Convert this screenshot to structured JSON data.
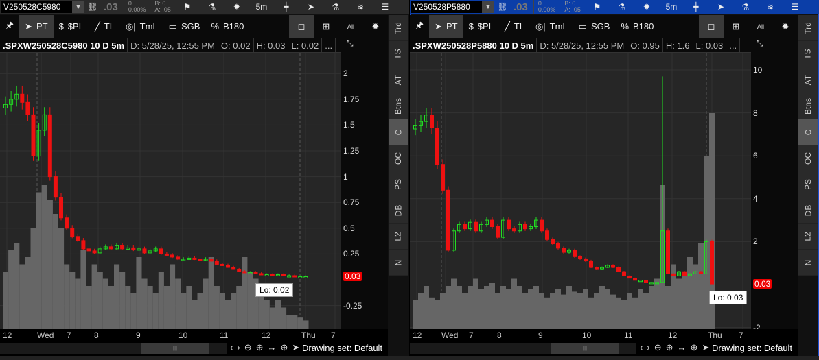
{
  "panels": [
    {
      "symbol": "V250528C5980",
      "last": ".03",
      "change": "0",
      "change_pct": "0.00%",
      "bid": "B: 0",
      "ask": "A: .05",
      "interval": "5m",
      "toolbar": {
        "pt": "PT",
        "pl": "$PL",
        "tl": "TL",
        "tml": "TmL",
        "sgb": "SGB",
        "b180": "B180",
        "all": "All"
      },
      "info": {
        "title": ".SPXW250528C5980 10 D 5m",
        "date": "D: 5/28/25, 12:55 PM",
        "open": "O: 0.02",
        "high": "H: 0.03",
        "low": "L: 0.02",
        "more": "..."
      },
      "axis": [
        {
          "v": 2,
          "t": "2"
        },
        {
          "v": 1.75,
          "t": "1.75"
        },
        {
          "v": 1.5,
          "t": "1.5"
        },
        {
          "v": 1.25,
          "t": "1.25"
        },
        {
          "v": 1,
          "t": "1"
        },
        {
          "v": 0.75,
          "t": "0.75"
        },
        {
          "v": 0.5,
          "t": "0.5"
        },
        {
          "v": 0.25,
          "t": "0.25"
        },
        {
          "v": -0.25,
          "t": "-0.25"
        }
      ],
      "current": "0.03",
      "current_value": 0.03,
      "lo_label": "Lo: 0.02",
      "closes": [
        1.7,
        1.75,
        1.8,
        1.72,
        1.6,
        1.2,
        1.45,
        1.6,
        1.0,
        0.8,
        0.6,
        0.5,
        0.42,
        0.38,
        0.3,
        0.28,
        0.26,
        0.3,
        0.32,
        0.3,
        0.33,
        0.3,
        0.31,
        0.29,
        0.3,
        0.26,
        0.28,
        0.3,
        0.25,
        0.24,
        0.22,
        0.2,
        0.2,
        0.21,
        0.2,
        0.19,
        0.2,
        0.18,
        0.15,
        0.14,
        0.12,
        0.1,
        0.08,
        0.07,
        0.07,
        0.06,
        0.05,
        0.05,
        0.04,
        0.05,
        0.04,
        0.04,
        0.03,
        0.03,
        0.03
      ],
      "volume": [
        40,
        55,
        60,
        45,
        50,
        70,
        95,
        100,
        90,
        80,
        70,
        45,
        40,
        35,
        55,
        30,
        45,
        40,
        35,
        30,
        45,
        40,
        30,
        25,
        50,
        35,
        30,
        25,
        40,
        30,
        45,
        35,
        25,
        30,
        20,
        25,
        35,
        50,
        30,
        25,
        20,
        25,
        30,
        50,
        40,
        35,
        25,
        20,
        15,
        20,
        15,
        10,
        10,
        8,
        6
      ],
      "time_labels": [
        "12",
        "Wed",
        "7",
        "8",
        "9",
        "10",
        "11",
        "12",
        "Thu",
        "7"
      ],
      "drawing_set": "Drawing set: Default"
    },
    {
      "symbol": "V250528P5880",
      "last": ".03",
      "change": "0",
      "change_pct": "0.00%",
      "bid": "B: 0",
      "ask": "A: .05",
      "interval": "5m",
      "toolbar": {
        "pt": "PT",
        "pl": "$PL",
        "tl": "TL",
        "tml": "TmL",
        "sgb": "SGB",
        "b180": "B180",
        "all": "All"
      },
      "info": {
        "title": ".SPXW250528P5880 10 D 5m",
        "date": "D: 5/28/25, 12:55 PM",
        "open": "O: 0.95",
        "high": "H: 1.6",
        "low": "L: 0.03",
        "more": "..."
      },
      "axis": [
        {
          "v": 10,
          "t": "10"
        },
        {
          "v": 8,
          "t": "8"
        },
        {
          "v": 6,
          "t": "6"
        },
        {
          "v": 4,
          "t": "4"
        },
        {
          "v": 2,
          "t": "2"
        },
        {
          "v": -2,
          "t": "-2"
        }
      ],
      "current": "0.03",
      "current_value": 0.03,
      "lo_label": "Lo: 0.03",
      "closes": [
        7.4,
        7.6,
        7.9,
        7.3,
        5.6,
        4.4,
        1.6,
        2.5,
        2.8,
        2.6,
        2.9,
        2.5,
        2.8,
        3.0,
        2.7,
        2.2,
        3.0,
        2.6,
        2.5,
        2.8,
        2.6,
        2.7,
        3.0,
        2.5,
        2.1,
        1.9,
        1.7,
        1.5,
        1.6,
        1.3,
        1.2,
        1.1,
        0.8,
        0.7,
        0.8,
        0.9,
        0.8,
        0.6,
        0.4,
        0.3,
        0.2,
        0.2,
        0.1,
        0.1,
        0.1,
        2.5,
        0.5,
        0.4,
        0.6,
        0.4,
        0.5,
        0.6,
        0.5,
        2.0,
        0.03
      ],
      "spike": {
        "index": 45,
        "high": 9.7
      },
      "volume": [
        20,
        25,
        30,
        22,
        20,
        25,
        30,
        35,
        30,
        25,
        30,
        35,
        28,
        30,
        32,
        25,
        30,
        28,
        35,
        30,
        25,
        28,
        30,
        25,
        22,
        25,
        28,
        24,
        30,
        26,
        25,
        28,
        22,
        25,
        30,
        28,
        24,
        22,
        20,
        25,
        22,
        28,
        25,
        30,
        35,
        100,
        30,
        45,
        35,
        40,
        50,
        45,
        60,
        120,
        150
      ],
      "time_labels": [
        "12",
        "Wed",
        "7",
        "8",
        "9",
        "10",
        "11",
        "12",
        "Thu",
        "7"
      ],
      "drawing_set": "Drawing set: Default"
    }
  ],
  "side_tabs": [
    "Trd",
    "TS",
    "AT",
    "Btns",
    "C",
    "OC",
    "PS",
    "DB",
    "L2",
    "N"
  ],
  "active_tab": "C",
  "colors": {
    "up": "#22dd22",
    "down": "#ee1111",
    "volume": "#666666",
    "selected_header": "#0b3ea8"
  }
}
